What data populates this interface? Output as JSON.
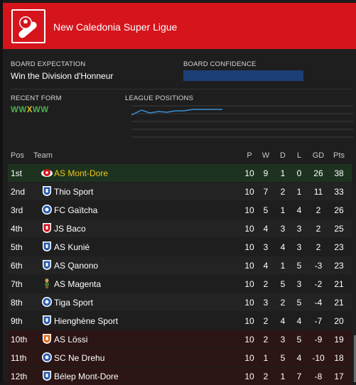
{
  "header": {
    "title": "New Caledonia Super Ligue",
    "logo_icon": "league-football-logo-icon"
  },
  "board": {
    "expectation_label": "BOARD EXPECTATION",
    "expectation_value": "Win the Division d'Honneur",
    "confidence_label": "BOARD CONFIDENCE",
    "confidence_level": 1.0
  },
  "form": {
    "label": "RECENT FORM",
    "results": [
      {
        "r": "W",
        "color": "#4caf50"
      },
      {
        "r": "W",
        "color": "#4caf50"
      },
      {
        "r": "X",
        "color": "#e6c229"
      },
      {
        "r": "W",
        "color": "#4caf50"
      },
      {
        "r": "W",
        "color": "#4caf50"
      }
    ]
  },
  "league_positions": {
    "label": "LEAGUE POSITIONS",
    "line_color": "#3a8fd6"
  },
  "table": {
    "headers": {
      "pos": "Pos",
      "team": "Team",
      "p": "P",
      "w": "W",
      "d": "D",
      "l": "L",
      "gd": "GD",
      "pts": "Pts"
    },
    "rows": [
      {
        "pos": "1st",
        "team": "AS Mont-Dore",
        "p": "10",
        "w": "9",
        "d": "1",
        "l": "0",
        "gd": "26",
        "pts": "38",
        "highlight": "user",
        "badge_color": "#d5141c",
        "badge_icon": "red-ball-crest-icon"
      },
      {
        "pos": "2nd",
        "team": "Thio Sport",
        "p": "10",
        "w": "7",
        "d": "2",
        "l": "1",
        "gd": "11",
        "pts": "33",
        "highlight": "none",
        "badge_color": "#2a5db0",
        "badge_icon": "blue-shield-crest-icon"
      },
      {
        "pos": "3rd",
        "team": "FC Gaïtcha",
        "p": "10",
        "w": "5",
        "d": "1",
        "l": "4",
        "gd": "2",
        "pts": "26",
        "highlight": "none",
        "badge_color": "#2a5db0",
        "badge_icon": "blue-round-crest-icon"
      },
      {
        "pos": "4th",
        "team": "JS Baco",
        "p": "10",
        "w": "4",
        "d": "3",
        "l": "3",
        "gd": "2",
        "pts": "25",
        "highlight": "none",
        "badge_color": "#d5141c",
        "badge_icon": "red-shield-crest-icon"
      },
      {
        "pos": "5th",
        "team": "AS Kunié",
        "p": "10",
        "w": "3",
        "d": "4",
        "l": "3",
        "gd": "2",
        "pts": "23",
        "highlight": "none",
        "badge_color": "#2a5db0",
        "badge_icon": "blue-shield-crest-icon"
      },
      {
        "pos": "6th",
        "team": "AS Qanono",
        "p": "10",
        "w": "4",
        "d": "1",
        "l": "5",
        "gd": "-3",
        "pts": "23",
        "highlight": "none",
        "badge_color": "#2a5db0",
        "badge_icon": "blue-shield-crest-icon"
      },
      {
        "pos": "7th",
        "team": "AS Magenta",
        "p": "10",
        "w": "2",
        "d": "5",
        "l": "3",
        "gd": "-2",
        "pts": "21",
        "highlight": "none",
        "badge_color": "#7a5a2a",
        "badge_icon": "brown-figure-crest-icon"
      },
      {
        "pos": "8th",
        "team": "Tiga Sport",
        "p": "10",
        "w": "3",
        "d": "2",
        "l": "5",
        "gd": "-4",
        "pts": "21",
        "highlight": "none",
        "badge_color": "#2a5db0",
        "badge_icon": "blue-round-crest-icon"
      },
      {
        "pos": "9th",
        "team": "Hienghène Sport",
        "p": "10",
        "w": "2",
        "d": "4",
        "l": "4",
        "gd": "-7",
        "pts": "20",
        "highlight": "none",
        "badge_color": "#2a5db0",
        "badge_icon": "blue-shield-crest-icon"
      },
      {
        "pos": "10th",
        "team": "AS Lössi",
        "p": "10",
        "w": "2",
        "d": "3",
        "l": "5",
        "gd": "-9",
        "pts": "19",
        "highlight": "relegation",
        "badge_color": "#e07020",
        "badge_icon": "orange-crest-icon"
      },
      {
        "pos": "11th",
        "team": "SC Ne Drehu",
        "p": "10",
        "w": "1",
        "d": "5",
        "l": "4",
        "gd": "-10",
        "pts": "18",
        "highlight": "relegation",
        "badge_color": "#2a5db0",
        "badge_icon": "blue-round-crest-icon"
      },
      {
        "pos": "12th",
        "team": "Bélep Mont-Dore",
        "p": "10",
        "w": "2",
        "d": "1",
        "l": "7",
        "gd": "-8",
        "pts": "17",
        "highlight": "relegation",
        "badge_color": "#2a5db0",
        "badge_icon": "blue-shield-crest-icon"
      }
    ]
  },
  "colors": {
    "header_bg": "#d5141c",
    "user_team_text": "#f0c419",
    "user_row_bg": "#1d3320",
    "relegation_row_bg": "#2c1515",
    "alt_row_bg": "#232323"
  }
}
